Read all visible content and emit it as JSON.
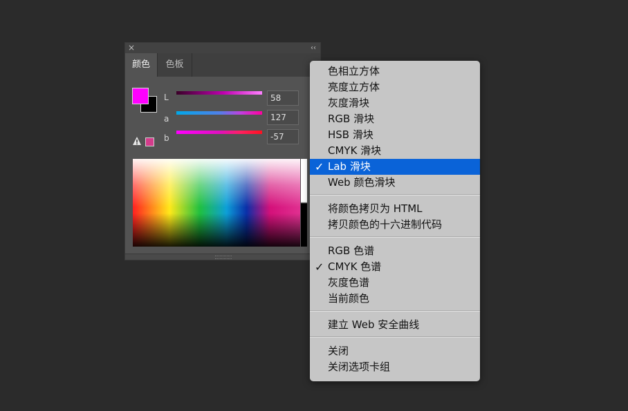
{
  "panel": {
    "close_icon": "×",
    "collapse_icon": "‹‹",
    "tabs": [
      {
        "label": "颜色",
        "active": true
      },
      {
        "label": "色板",
        "active": false
      }
    ],
    "menu_icon": "≡",
    "foreground_color": "#ff00ff",
    "background_color": "#000000",
    "gamut_warning_color": "#d43c8c",
    "channels": [
      {
        "label": "L",
        "value": "58",
        "level": 0.58
      },
      {
        "label": "a",
        "value": "127",
        "level": 1.0
      },
      {
        "label": "b",
        "value": "-57",
        "level": 0.28
      }
    ]
  },
  "context_menu": {
    "groups": [
      [
        {
          "label": "色相立方体",
          "checked": false,
          "selected": false
        },
        {
          "label": "亮度立方体",
          "checked": false,
          "selected": false
        },
        {
          "label": "灰度滑块",
          "checked": false,
          "selected": false
        },
        {
          "label": "RGB 滑块",
          "checked": false,
          "selected": false
        },
        {
          "label": "HSB 滑块",
          "checked": false,
          "selected": false
        },
        {
          "label": "CMYK 滑块",
          "checked": false,
          "selected": false
        },
        {
          "label": "Lab 滑块",
          "checked": true,
          "selected": true
        },
        {
          "label": "Web 颜色滑块",
          "checked": false,
          "selected": false
        }
      ],
      [
        {
          "label": "将颜色拷贝为 HTML",
          "checked": false,
          "selected": false
        },
        {
          "label": "拷贝颜色的十六进制代码",
          "checked": false,
          "selected": false
        }
      ],
      [
        {
          "label": "RGB 色谱",
          "checked": false,
          "selected": false
        },
        {
          "label": "CMYK 色谱",
          "checked": true,
          "selected": false
        },
        {
          "label": "灰度色谱",
          "checked": false,
          "selected": false
        },
        {
          "label": "当前颜色",
          "checked": false,
          "selected": false
        }
      ],
      [
        {
          "label": "建立 Web 安全曲线",
          "checked": false,
          "selected": false
        }
      ],
      [
        {
          "label": "关闭",
          "checked": false,
          "selected": false
        },
        {
          "label": "关闭选项卡组",
          "checked": false,
          "selected": false
        }
      ]
    ],
    "check_mark": "✓"
  },
  "colors": {
    "highlight": "#0a63d8",
    "menu_bg": "#c6c6c6",
    "panel_bg": "#535353",
    "page_bg": "#2b2b2b"
  }
}
